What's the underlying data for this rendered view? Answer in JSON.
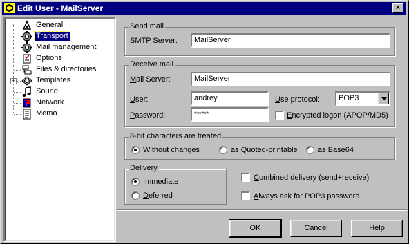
{
  "window": {
    "title": "Edit User - MailServer",
    "close_glyph": "×"
  },
  "tree": {
    "items": [
      {
        "label": "General",
        "icon": "general-icon"
      },
      {
        "label": "Transport",
        "icon": "gear-icon",
        "selected": true
      },
      {
        "label": "Mail management",
        "icon": "gear-icon"
      },
      {
        "label": "Options",
        "icon": "options-icon"
      },
      {
        "label": "Files & directories",
        "icon": "files-icon"
      },
      {
        "label": "Templates",
        "icon": "templates-icon",
        "expander": "+"
      },
      {
        "label": "Sound",
        "icon": "sound-icon"
      },
      {
        "label": "Network",
        "icon": "network-icon"
      },
      {
        "label": "Memo",
        "icon": "memo-icon"
      }
    ]
  },
  "send_mail": {
    "group_title": "Send mail",
    "smtp_label_prefix": "",
    "smtp_label_key": "S",
    "smtp_label_rest": "MTP Server:",
    "smtp_value": "MailServer"
  },
  "receive_mail": {
    "group_title": "Receive mail",
    "server_label_key": "M",
    "server_label_rest": "ail Server:",
    "server_value": "MailServer",
    "user_label_key": "U",
    "user_label_rest": "ser:",
    "user_value": "andrey",
    "protocol_label_key": "U",
    "protocol_label_rest": "se protocol:",
    "protocol_value": "POP3",
    "password_label_key": "P",
    "password_label_rest": "assword:",
    "password_value": "******",
    "encrypted_key": "E",
    "encrypted_rest": "ncrypted logon (APOP/MD5)",
    "encrypted_checked": false
  },
  "eight_bit": {
    "group_title": "8-bit characters are treated",
    "option1_key": "W",
    "option1_rest": "ithout changes",
    "option2_pre": "as ",
    "option2_key": "Q",
    "option2_rest": "uoted-printable",
    "option3_pre": "as ",
    "option3_key": "B",
    "option3_rest": "ase64",
    "selected": "Without changes"
  },
  "delivery": {
    "group_title": "Delivery",
    "immediate_key": "I",
    "immediate_rest": "mmediate",
    "deferred_key": "D",
    "deferred_rest": "eferred",
    "selected": "Immediate",
    "combined_key": "C",
    "combined_rest": "ombined delivery (send+receive)",
    "always_key": "A",
    "always_rest": "lways ask for POP3 password"
  },
  "buttons": {
    "ok": "OK",
    "cancel": "Cancel",
    "help": "Help"
  }
}
